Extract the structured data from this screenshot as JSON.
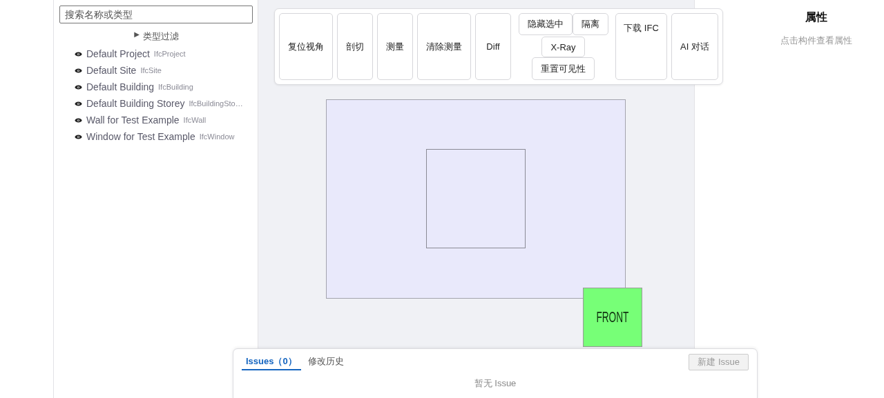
{
  "search": {
    "placeholder": "搜索名称或类型"
  },
  "type_filter": {
    "toggle": "▶",
    "label": "类型过滤",
    "expanded": false
  },
  "tree": [
    {
      "name": "Default Project",
      "type": "IfcProject",
      "visible": true
    },
    {
      "name": "Default Site",
      "type": "IfcSite",
      "visible": true
    },
    {
      "name": "Default Building",
      "type": "IfcBuilding",
      "visible": true
    },
    {
      "name": "Default Building Storey",
      "type": "IfcBuildingSto…",
      "visible": true
    },
    {
      "name": "Wall for Test Example",
      "type": "IfcWall",
      "visible": true
    },
    {
      "name": "Window for Test Example",
      "type": "IfcWindow",
      "visible": true
    }
  ],
  "toolbar": [
    {
      "kind": "button",
      "label": "复位视角"
    },
    {
      "kind": "button",
      "label": "剖切"
    },
    {
      "kind": "button",
      "label": "测量"
    },
    {
      "kind": "button",
      "label": "清除测量"
    },
    {
      "kind": "button",
      "label": "Diff"
    },
    {
      "kind": "cluster",
      "buttons": [
        "隐藏选中",
        "隔离",
        "X-Ray",
        "重置可见性"
      ]
    },
    {
      "kind": "top",
      "label": "下载 IFC"
    },
    {
      "kind": "button",
      "label": "AI 对话"
    }
  ],
  "view_cube": {
    "label": "FRONT"
  },
  "issues": {
    "tabs": [
      {
        "label": "Issues（0）",
        "selected": true
      },
      {
        "label": "修改历史",
        "selected": false
      }
    ],
    "new_button": {
      "label": "新建 Issue",
      "disabled": true
    },
    "empty": "暂无 Issue"
  },
  "properties": {
    "title": "属性",
    "hint": "点击构件查看属性"
  }
}
